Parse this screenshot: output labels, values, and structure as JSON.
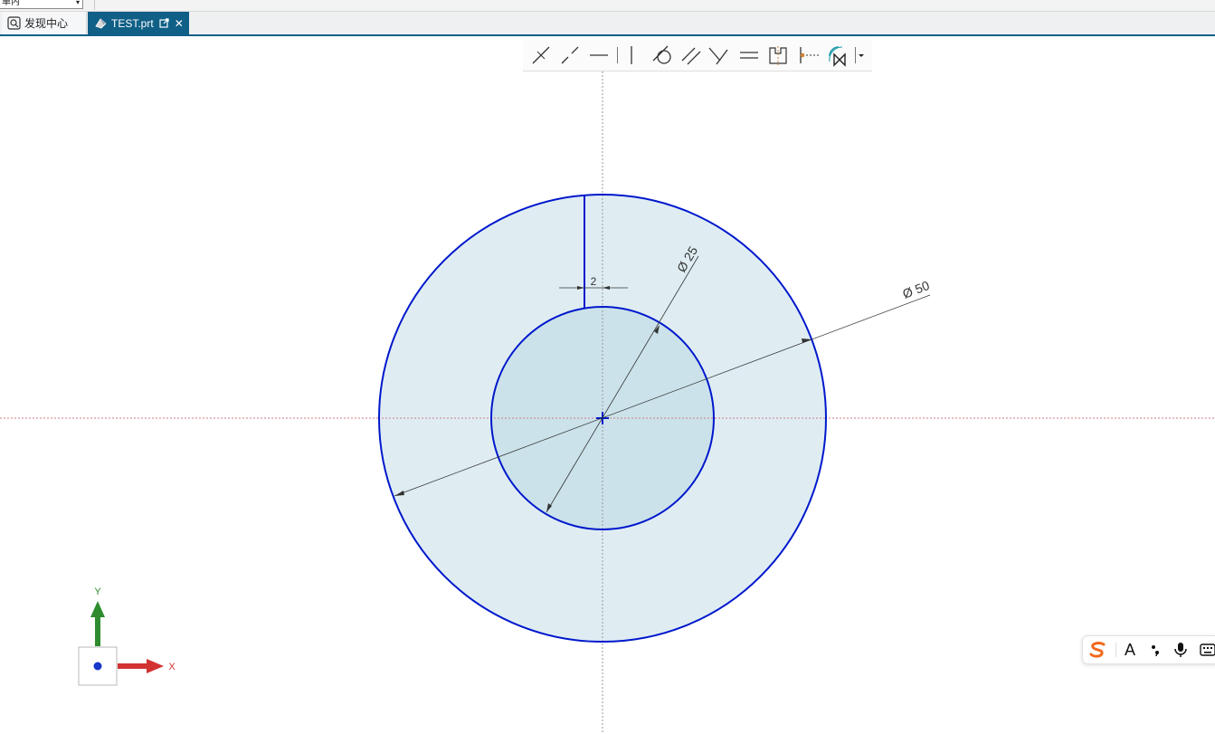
{
  "topbar": {
    "filter_value": "单内"
  },
  "tabs": [
    {
      "label": "发现中心",
      "icon": "discovery-center-icon"
    },
    {
      "label": "TEST.prt",
      "icon": "part-file-icon",
      "active": true
    }
  ],
  "sketch_toolbar": {
    "tools": [
      "coincident-icon",
      "point-on-curve-icon",
      "horizontal-icon",
      "vertical-icon",
      "tangent-icon",
      "parallel-icon",
      "perpendicular-icon",
      "equal-length-icon",
      "symmetric-icon",
      "midpoint-icon",
      "fixed-constraint-icon",
      "more-dropdown-icon"
    ]
  },
  "sketch": {
    "dimensions": {
      "gap": "2",
      "inner_diameter": "Ø 25",
      "outer_diameter": "Ø 50"
    },
    "colors": {
      "curve": "#0018cc",
      "fill": "#dfedf3",
      "inner_fill": "#cbe2ea",
      "dimension": "#333333",
      "axis_h": "#d07a85",
      "axis_v": "#9a9a9a"
    }
  },
  "triad": {
    "x_label": "X",
    "y_label": "Y",
    "x_color": "#d23232",
    "y_color": "#2e8b2e"
  },
  "ime_bar": {
    "mode_label": "A",
    "items": [
      "sogou-logo-icon",
      "punctuation-icon",
      "microphone-icon",
      "keyboard-icon"
    ]
  }
}
